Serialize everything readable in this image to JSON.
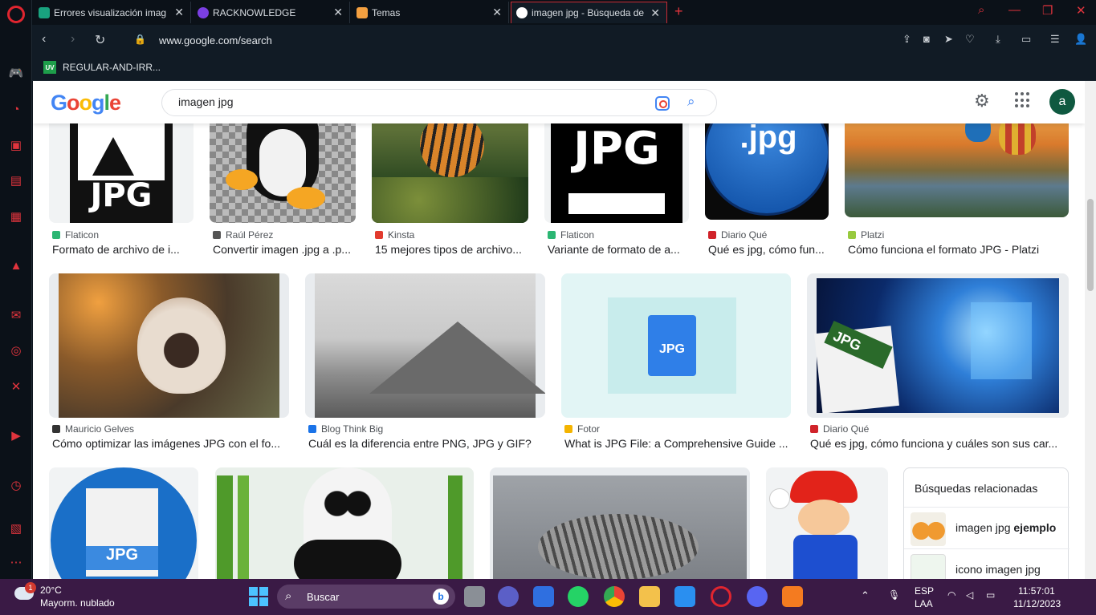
{
  "browser": {
    "tabs": [
      {
        "title": "Errores visualización image",
        "favicon_color": "#19a37f"
      },
      {
        "title": "RACKNOWLEDGE",
        "favicon_color": "#7b3fe4"
      },
      {
        "title": "Temas",
        "favicon_color": "#f4a040"
      },
      {
        "title": "imagen jpg - Búsqueda de",
        "favicon_color": "#ffffff"
      }
    ],
    "new_tab": "+",
    "url": "www.google.com/search",
    "bookmark": {
      "badge": "UV",
      "label": "REGULAR-AND-IRR..."
    }
  },
  "google": {
    "logo": "Google",
    "query": "imagen jpg",
    "avatar_letter": "a"
  },
  "results_row1": [
    {
      "source": "Flaticon",
      "caption": "Formato de archivo de i...",
      "source_color": "#2bb673"
    },
    {
      "source": "Raúl Pérez",
      "caption": "Convertir imagen .jpg a .p...",
      "source_color": "#555555"
    },
    {
      "source": "Kinsta",
      "caption": "15 mejores tipos de archivo...",
      "source_color": "#e23b2e"
    },
    {
      "source": "Flaticon",
      "caption": "Variante de formato de a...",
      "source_color": "#2bb673"
    },
    {
      "source": "Diario Qué",
      "caption": "Qué es jpg, cómo fun...",
      "source_color": "#d0232a"
    },
    {
      "source": "Platzi",
      "caption": "Cómo funciona el formato JPG - Platzi",
      "source_color": "#98ca3f"
    }
  ],
  "results_row2": [
    {
      "source": "Mauricio Gelves",
      "caption": "Cómo optimizar las imágenes JPG con el fo...",
      "source_color": "#333333"
    },
    {
      "source": "Blog Think Big",
      "caption": "Cuál es la diferencia entre PNG, JPG y GIF?",
      "source_color": "#1a73e8"
    },
    {
      "source": "Fotor",
      "caption": "What is JPG File: a Comprehensive Guide ...",
      "source_color": "#f4b400"
    },
    {
      "source": "Diario Qué",
      "caption": "Qué es jpg, cómo funciona y cuáles son sus car...",
      "source_color": "#d0232a"
    }
  ],
  "image_labels": {
    "jpg_icon_1": "JPG",
    "jpg_icon_2": "JPG",
    "jpg_dot": ".jpg",
    "fotor_jpg": "JPG",
    "windows_jpg": "JPG",
    "blue_jpg": "JPG"
  },
  "related": {
    "title": "Búsquedas relacionadas",
    "items": [
      {
        "prefix": "imagen jpg ",
        "bold": "ejemplo"
      },
      {
        "prefix": "icono imagen jpg",
        "bold": ""
      }
    ]
  },
  "taskbar": {
    "weather_badge": "1",
    "temperature": "20°C",
    "condition": "Mayorm. nublado",
    "search_label": "Buscar",
    "language": "ESP",
    "layout": "LAA",
    "time": "11:57:01",
    "date": "11/12/2023"
  },
  "colors": {
    "opera_red": "#e0252f",
    "taskbar": "#3a1a45",
    "google_blue": "#4285f4"
  }
}
